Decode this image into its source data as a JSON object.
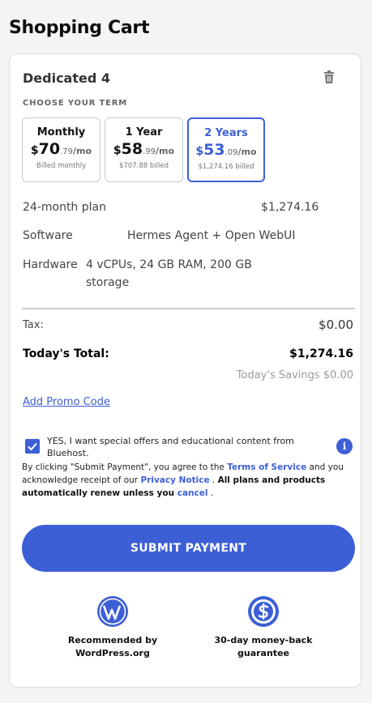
{
  "page": {
    "title": "Shopping Cart"
  },
  "product": {
    "name": "Dedicated 4"
  },
  "term_section": {
    "label": "CHOOSE YOUR TERM"
  },
  "terms": [
    {
      "name": "Monthly",
      "currency": "$",
      "dollars": "70",
      "cents": ".79",
      "unit": "/mo",
      "billed": "Billed monthly",
      "selected": false
    },
    {
      "name": "1 Year",
      "currency": "$",
      "dollars": "58",
      "cents": ".99",
      "unit": "/mo",
      "billed": "$707.88 billed",
      "selected": false
    },
    {
      "name": "2 Years",
      "currency": "$",
      "dollars": "53",
      "cents": ".09",
      "unit": "/mo",
      "billed": "$1,274.16 billed",
      "selected": true
    }
  ],
  "details": {
    "plan_label": "24-month plan",
    "plan_price": "$1,274.16",
    "software_label": "Software",
    "software_value": "Hermes Agent + Open WebUI",
    "hardware_label": "Hardware",
    "hardware_value": "4 vCPUs, 24 GB RAM, 200 GB storage"
  },
  "summary": {
    "tax_label": "Tax:",
    "tax_value": "$0.00",
    "total_label": "Today's Total:",
    "total_value": "$1,274.16",
    "savings": "Today's Savings $0.00"
  },
  "promo": {
    "label": "Add Promo Code"
  },
  "offers": {
    "checked": true,
    "text": "YES, I want special offers and educational content from Bluehost."
  },
  "legal": {
    "part1": "By clicking \"Submit Payment\", you agree to the ",
    "terms_link": "Terms of Service",
    "part2": " and you acknowledge receipt of our ",
    "privacy_link": "Privacy Notice",
    "part3": " . ",
    "bold": "All plans and products automatically renew unless you ",
    "cancel_link": "cancel",
    "part4": " ."
  },
  "submit": {
    "label": "SUBMIT PAYMENT"
  },
  "badges": {
    "wordpress": "Recommended by WordPress.org",
    "money_back": "30-day money-back guarantee"
  },
  "colors": {
    "accent": "#3d5fd6"
  }
}
